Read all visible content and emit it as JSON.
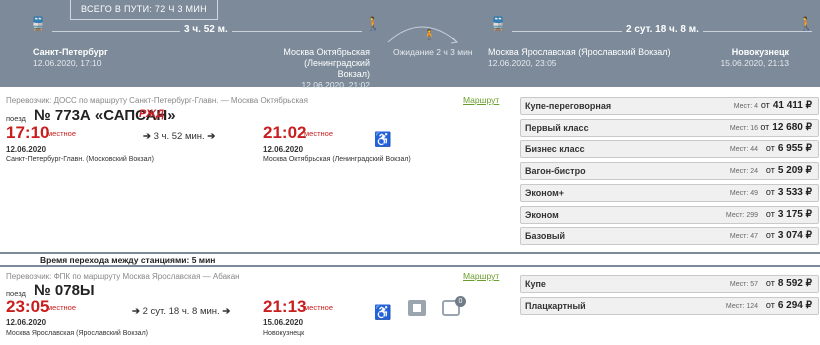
{
  "header": {
    "total_label": "ВСЕГО В ПУТИ: 72 Ч 3 МИН",
    "seg1_duration": "3 ч. 52 м.",
    "seg2_duration": "2 сут. 18 ч. 8 м.",
    "wait": "Ожидание 2 ч 3 мин",
    "origin": {
      "name": "Санкт-Петербург",
      "datetime": "12.06.2020, 17:10"
    },
    "mid1": {
      "name1": "Москва Октябрьская (Ленинградский",
      "name2": "Вокзал)",
      "datetime": "12.06.2020, 21:02"
    },
    "mid2": {
      "name": "Москва Ярославская (Ярославский Вокзал)",
      "datetime": "12.06.2020, 23:05"
    },
    "dest": {
      "name": "Новокузнецк",
      "datetime": "15.06.2020, 21:13"
    }
  },
  "train1": {
    "carrier": "Перевозчик: ДОСС   по маршруту Санкт-Петербург-Главн. — Москва Октябрьская",
    "route_link": "Маршрут",
    "poezd": "поезд",
    "number": "№ 773А «САПСАН»",
    "logo": "РЖД",
    "dep_time": "17:10",
    "dep_local": "местное",
    "duration": "3 ч. 52 мин.",
    "arr_time": "21:02",
    "arr_local": "местное",
    "dep_date": "12.06.2020",
    "arr_date": "12.06.2020",
    "dep_station": "Санкт-Петербург-Главн. (Московский Вокзал)",
    "arr_station": "Москва Октябрьская (Ленинградский Вокзал)",
    "seats": [
      {
        "cls": "Купе-переговорная",
        "count": "Мест: 4",
        "ot": "от",
        "price": "41 411 ₽"
      },
      {
        "cls": "Первый класс",
        "count": "Мест: 16",
        "ot": "от",
        "price": "12 680 ₽"
      },
      {
        "cls": "Бизнес класс",
        "count": "Мест: 44",
        "ot": "от",
        "price": "6 955 ₽"
      },
      {
        "cls": "Вагон-бистро",
        "count": "Мест: 24",
        "ot": "от",
        "price": "5 209 ₽"
      },
      {
        "cls": "Эконом+",
        "count": "Мест: 49",
        "ot": "от",
        "price": "3 533 ₽"
      },
      {
        "cls": "Эконом",
        "count": "Мест: 299",
        "ot": "от",
        "price": "3 175 ₽"
      },
      {
        "cls": "Базовый",
        "count": "Мест: 47",
        "ot": "от",
        "price": "3 074 ₽"
      }
    ]
  },
  "transfer": "Время перехода между станциями: 5 мин",
  "train2": {
    "carrier": "Перевозчик: ФПК   по маршруту Москва Ярославская — Абакан",
    "route_link": "Маршрут",
    "poezd": "поезд",
    "number": "№ 078Ы",
    "dep_time": "23:05",
    "dep_local": "местное",
    "duration": "2 сут. 18 ч. 8 мин.",
    "arr_time": "21:13",
    "arr_local": "местное",
    "dep_date": "12.06.2020",
    "arr_date": "15.06.2020",
    "dep_station": "Москва Ярославская (Ярославский Вокзал)",
    "arr_station": "Новокузнецк",
    "bus_badge": "0",
    "seats": [
      {
        "cls": "Купе",
        "count": "Мест: 57",
        "ot": "от",
        "price": "8 592 ₽"
      },
      {
        "cls": "Плацкартный",
        "count": "Мест: 124",
        "ot": "от",
        "price": "6 294 ₽"
      }
    ]
  }
}
